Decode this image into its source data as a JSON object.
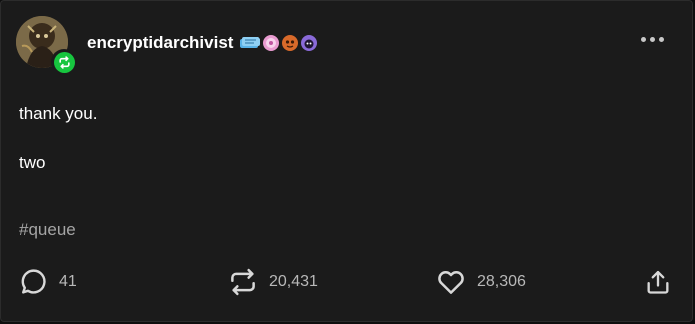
{
  "post": {
    "username": "encryptidarchivist",
    "body": [
      "thank you.",
      "two"
    ],
    "tag": "#queue"
  },
  "badges": [
    {
      "name": "scroll-badge",
      "color": "#5ab3e8"
    },
    {
      "name": "pink-badge",
      "color": "#e99bd0"
    },
    {
      "name": "orange-badge",
      "color": "#d86a2a"
    },
    {
      "name": "purple-badge",
      "color": "#8a6ad8"
    }
  ],
  "actions": {
    "replies": "41",
    "reblogs": "20,431",
    "likes": "28,306"
  },
  "colors": {
    "background": "#1b1b1b",
    "reblog_green": "#17c63f",
    "muted_text": "#a5a5a5"
  },
  "icons": {
    "reply": "speech-bubble-icon",
    "reblog": "reblog-icon",
    "like": "heart-icon",
    "share": "share-icon",
    "more": "more-dots-icon"
  }
}
